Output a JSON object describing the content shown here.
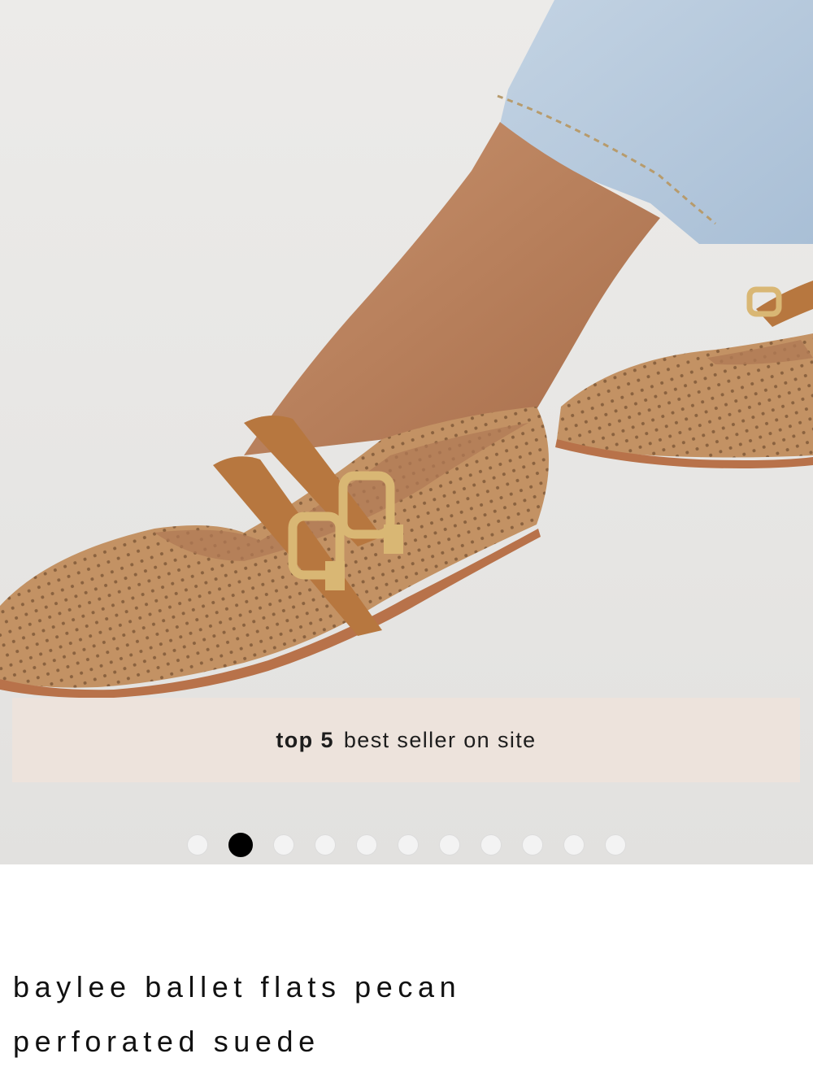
{
  "gallery": {
    "image_alt": "baylee ballet flats pecan perforated suede worn on foot",
    "active_index": 1,
    "dot_count": 11
  },
  "badge": {
    "bold_text": "top 5",
    "text": "best seller on site"
  },
  "product": {
    "title_line1": "baylee ballet flats pecan",
    "title_line2": "perforated suede"
  },
  "colors": {
    "badge_bg": "#ede3dc",
    "suede": "#c39264",
    "strap": "#b7773f",
    "buckle": "#d9b774",
    "dot_active": "#000000",
    "dot_inactive": "#f3f3f3"
  }
}
